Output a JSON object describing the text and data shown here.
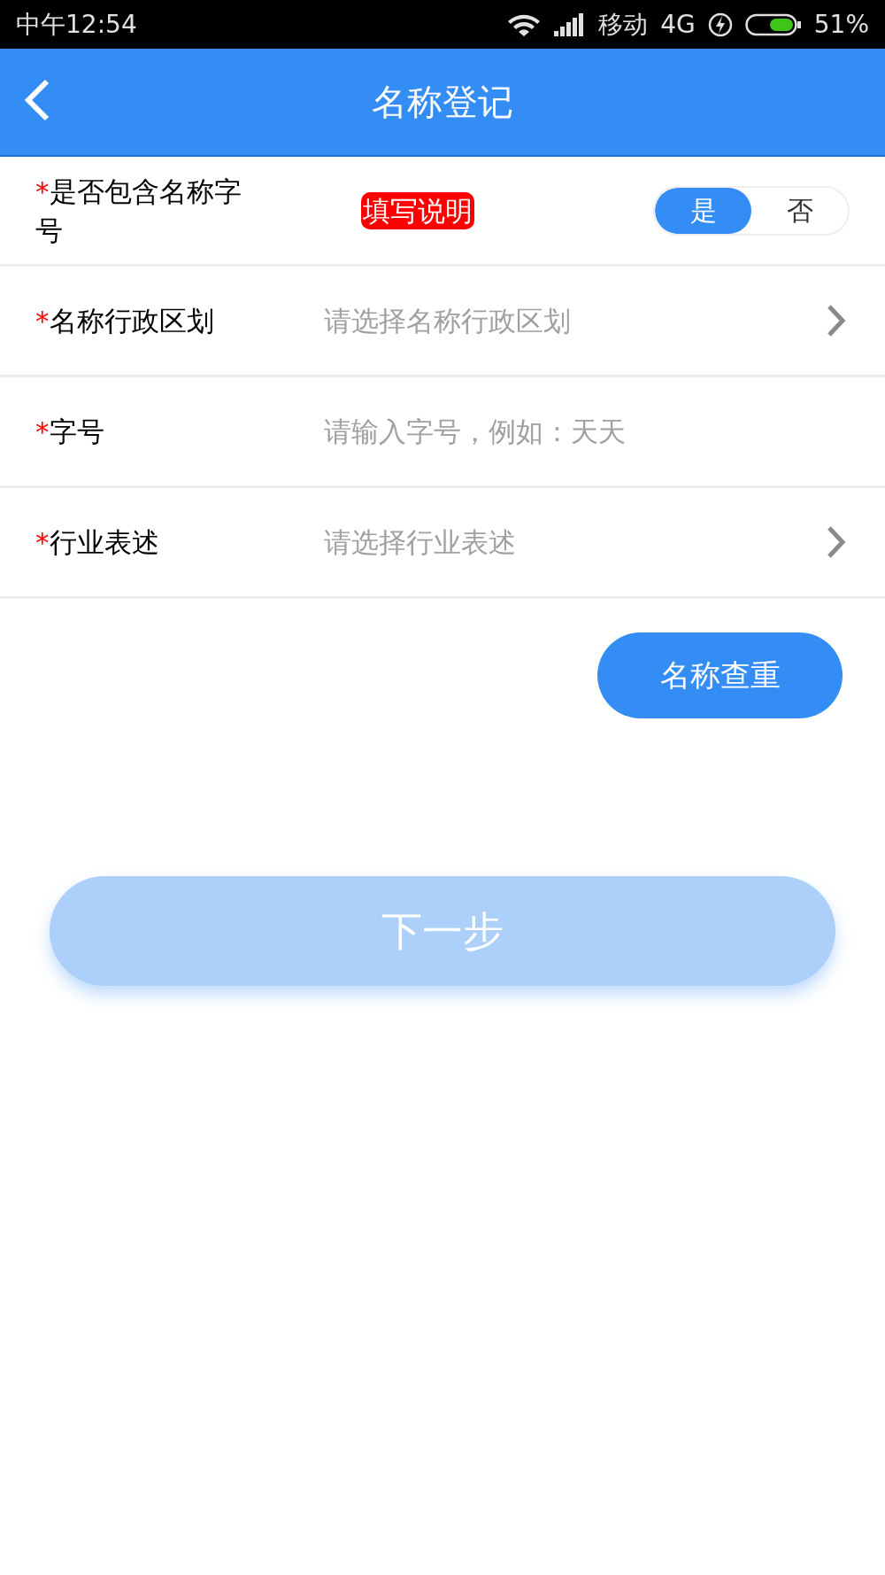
{
  "status_bar": {
    "time": "中午12:54",
    "carrier": "移动",
    "network": "4G",
    "battery": "51%"
  },
  "header": {
    "title": "名称登记"
  },
  "toggle_row": {
    "label": "是否包含名称字号",
    "required_mark": "*",
    "help_badge": "填写说明",
    "options": [
      {
        "label": "是",
        "selected": true
      },
      {
        "label": "否",
        "selected": false
      }
    ]
  },
  "fields": [
    {
      "kind": "select",
      "label": "名称行政区划",
      "required_mark": "*",
      "placeholder": "请选择名称行政区划"
    },
    {
      "kind": "input",
      "label": "字号",
      "required_mark": "*",
      "placeholder": "请输入字号，例如：天天"
    },
    {
      "kind": "select",
      "label": "行业表述",
      "required_mark": "*",
      "placeholder": "请选择行业表述"
    }
  ],
  "check_button": "名称查重",
  "next_button": {
    "label": "下一步",
    "disabled": true
  }
}
